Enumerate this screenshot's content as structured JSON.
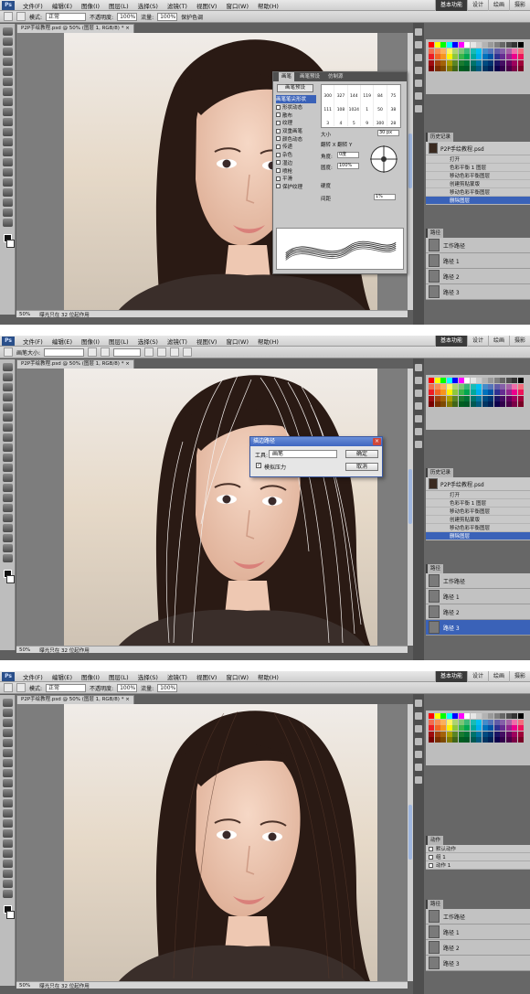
{
  "app": {
    "logo": "Ps",
    "menus": [
      "文件(F)",
      "编辑(E)",
      "图像(I)",
      "图层(L)",
      "选择(S)",
      "滤镜(T)",
      "视图(V)",
      "窗口(W)",
      "帮助(H)"
    ],
    "workspace": [
      "基本功能",
      "设计",
      "绘画",
      "摄影"
    ]
  },
  "screens": [
    {
      "options": {
        "mode_label": "模式:",
        "mode": "正常",
        "opacity_label": "不透明度:",
        "opacity": "100%",
        "flow_label": "流量:",
        "flow": "100%",
        "protect": "保护色调"
      },
      "doc_tab": "P2P手绘教程.psd @ 50% (图层 1, RGB/8) * ×",
      "status": {
        "zoom": "50%",
        "info": "曝光只在 32 位起作用"
      },
      "brush_panel": {
        "tabs": [
          "画笔",
          "画笔预设",
          "仿制源"
        ],
        "preset_button": "画笔预设",
        "options": [
          "画笔笔尖形状",
          "形状动态",
          "散布",
          "纹理",
          "双重画笔",
          "颜色动态",
          "传递",
          "杂色",
          "湿边",
          "喷枪",
          "平滑",
          "保护纹理"
        ],
        "selected_option": 0,
        "brush_sizes": [
          "300",
          "327",
          "144",
          "119",
          "84",
          "75",
          "111",
          "108",
          "1024",
          "1",
          "50",
          "38",
          "3",
          "4",
          "5",
          "9",
          "300",
          "28"
        ],
        "size_label": "大小",
        "size_value": "30 px",
        "flip": "翻转 X  翻转 Y",
        "angle_label": "角度:",
        "angle_value": "0度",
        "roundness_label": "圆度:",
        "roundness_value": "100%",
        "hardness_label": "硬度",
        "spacing_label": "间距",
        "spacing_value": "1%"
      },
      "history": {
        "tabs": [
          "历史记录"
        ],
        "snapshot": "P2P手绘教程.psd",
        "steps": [
          "打开",
          "色彩平衡 1 图层",
          "移动色彩平衡图层",
          "创建剪贴蒙版",
          "移动色彩平衡图层",
          "删除图层"
        ],
        "selected": 5
      },
      "paths": {
        "tabs": [
          "路径"
        ],
        "items": [
          "工作路径",
          "路径 1",
          "路径 2",
          "路径 3"
        ],
        "selected": -1
      }
    },
    {
      "options": {
        "mode_label": "画笔大小:",
        "mode": "",
        "opacity_label": "不透明度:",
        "opacity": "",
        "flow_label": "流量:",
        "flow": "",
        "protect": ""
      },
      "doc_tab": "P2P手绘教程.psd @ 50% (图层 1, RGB/8) * ×",
      "status": {
        "zoom": "50%",
        "info": "曝光只在 32 位起作用"
      },
      "dialog": {
        "title": "描边路径",
        "tool_label": "工具:",
        "tool_value": "画笔",
        "simulate": "模拟压力",
        "ok": "确定",
        "cancel": "取消",
        "close": "×"
      },
      "history": {
        "tabs": [
          "历史记录"
        ],
        "snapshot": "P2P手绘教程.psd",
        "steps": [
          "打开",
          "色彩平衡 1 图层",
          "移动色彩平衡图层",
          "创建剪贴蒙版",
          "移动色彩平衡图层",
          "删除图层"
        ],
        "selected": 5
      },
      "paths": {
        "tabs": [
          "路径"
        ],
        "items": [
          "工作路径",
          "路径 1",
          "路径 2",
          "路径 3"
        ],
        "selected": 3
      }
    },
    {
      "options": {
        "mode_label": "模式:",
        "mode": "正常",
        "opacity_label": "不透明度:",
        "opacity": "100%",
        "flow_label": "流量:",
        "flow": "100%",
        "protect": ""
      },
      "doc_tab": "P2P手绘教程.psd @ 50% (图层 1, RGB/8) * ×",
      "status": {
        "zoom": "50%",
        "info": "曝光只在 32 位起作用"
      },
      "layers": {
        "tabs": [
          "动作"
        ],
        "rows": [
          "默认动作",
          "组 1",
          "动作 1"
        ]
      },
      "paths": {
        "tabs": [
          "路径"
        ],
        "items": [
          "工作路径",
          "路径 1",
          "路径 2",
          "路径 3"
        ],
        "selected": -1
      }
    }
  ],
  "colors": {
    "accent": "#3a62b8",
    "photo_bg": "#e6d9c8",
    "hair": "#2a1a14",
    "skin": "#eec8b2"
  }
}
